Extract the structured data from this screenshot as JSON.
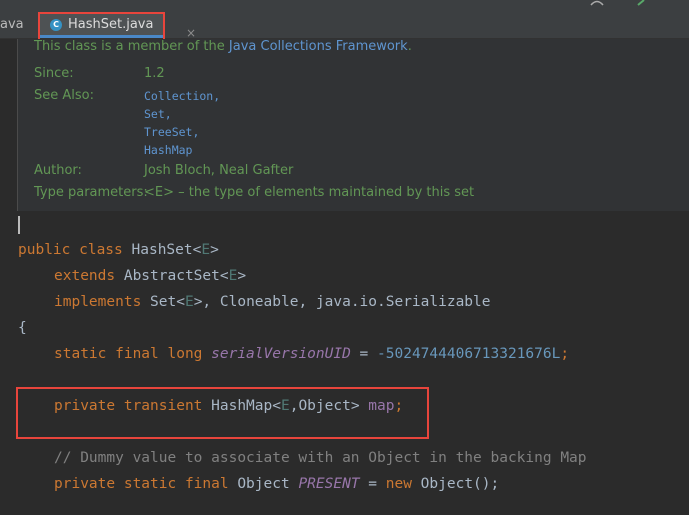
{
  "tabbar": {
    "previous_tab_fragment": "ava",
    "active_tab": {
      "icon": "class-icon",
      "icon_letter": "C",
      "label": "HashSet.java",
      "close_glyph": "×"
    }
  },
  "doc": {
    "intro_prefix": "This class is a member of the",
    "intro_link": "Java Collections Framework",
    "intro_suffix": ".",
    "since_label": "Since:",
    "since_value": "1.2",
    "see_also_label": "See Also:",
    "see_also": [
      "Collection,",
      "Set,",
      "TreeSet,",
      "HashMap"
    ],
    "author_label": "Author:",
    "author_value": "Josh Bloch, Neal Gafter",
    "type_params_label": "Type parameters:",
    "type_params_value": "<E> – the type of elements maintained by this set"
  },
  "code": {
    "l1": {
      "kw": "public class ",
      "name": "HashSet<",
      "gp": "E",
      "end": ">"
    },
    "l2": {
      "kw": "extends ",
      "name": "AbstractSet<",
      "gp": "E",
      "end": ">"
    },
    "l3": {
      "kw": "implements ",
      "name": "Set<",
      "gp": "E",
      "rest": ">, Cloneable, java.io.Serializable"
    },
    "l4": "{",
    "l5": {
      "kw": "static final long ",
      "field": "serialVersionUID",
      "eq": " = ",
      "num": "-5024744406713321676L",
      "semi": ";"
    },
    "l6": {
      "kw": "private transient ",
      "type": "HashMap<",
      "gp": "E",
      "rest": ",Object> ",
      "field": "map",
      "semi": ";"
    },
    "l7": "// Dummy value to associate with an Object in the backing Map",
    "l8": {
      "kw": "private static final ",
      "type": "Object ",
      "field": "PRESENT",
      "eq": " = ",
      "kw2": "new ",
      "rest": "Object();"
    }
  }
}
